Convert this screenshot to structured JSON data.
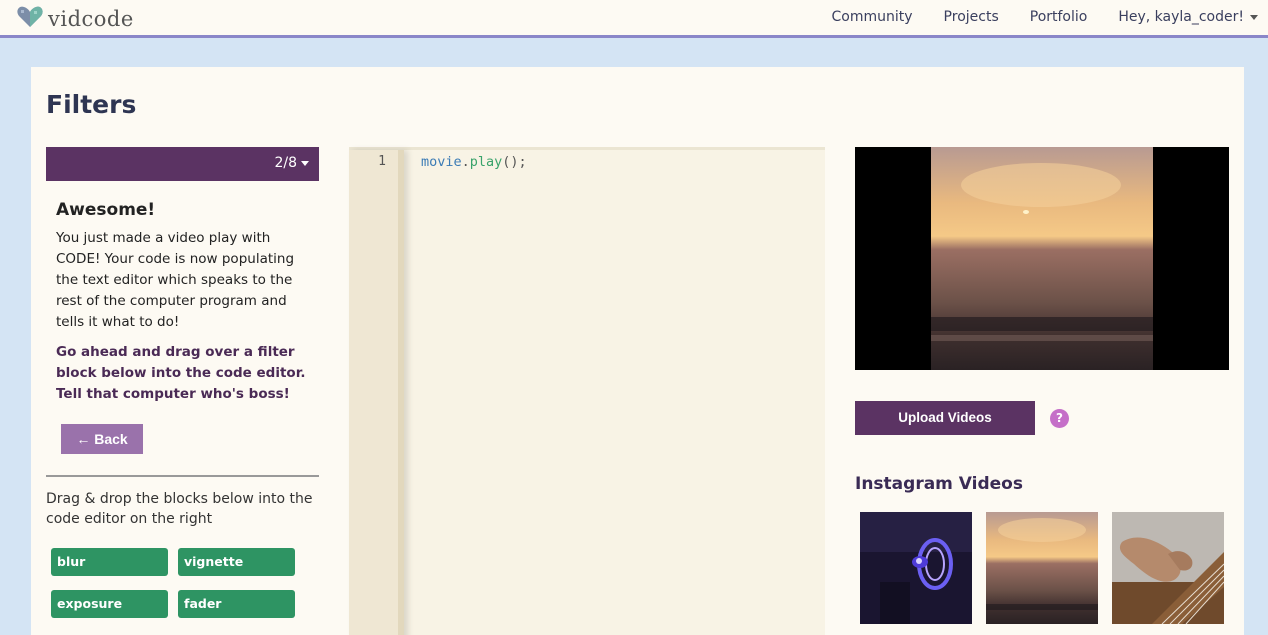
{
  "header": {
    "logo_text": "vidcode",
    "nav": [
      {
        "label": "Community"
      },
      {
        "label": "Projects"
      },
      {
        "label": "Portfolio"
      },
      {
        "label": "Hey, kayla_coder!"
      }
    ]
  },
  "page": {
    "title": "Filters"
  },
  "lesson": {
    "step": "2/8",
    "title": "Awesome!",
    "text": "You just made a video play with CODE! Your code is now populating the text editor which speaks to the rest of the computer program and tells it what to do!",
    "instruction": "Go ahead and drag over a filter block below into the code editor. Tell that computer who's boss!",
    "back_label": "← Back"
  },
  "blocks": {
    "drag_text": "Drag & drop the blocks below into the code editor on the right",
    "items": [
      {
        "label": "blur"
      },
      {
        "label": "vignette"
      },
      {
        "label": "exposure"
      },
      {
        "label": "fader"
      }
    ]
  },
  "editor": {
    "line_number": "1",
    "code_object": "movie",
    "code_dot": ".",
    "code_method": "play",
    "code_rest": "();"
  },
  "sidebar": {
    "upload_label": "Upload Videos",
    "help_glyph": "?",
    "instagram_title": "Instagram Videos"
  },
  "colors": {
    "brand_purple": "#5b3363",
    "block_green": "#2e9463",
    "back_purple": "#9a72ab",
    "nav_accent": "#8a86c8"
  }
}
